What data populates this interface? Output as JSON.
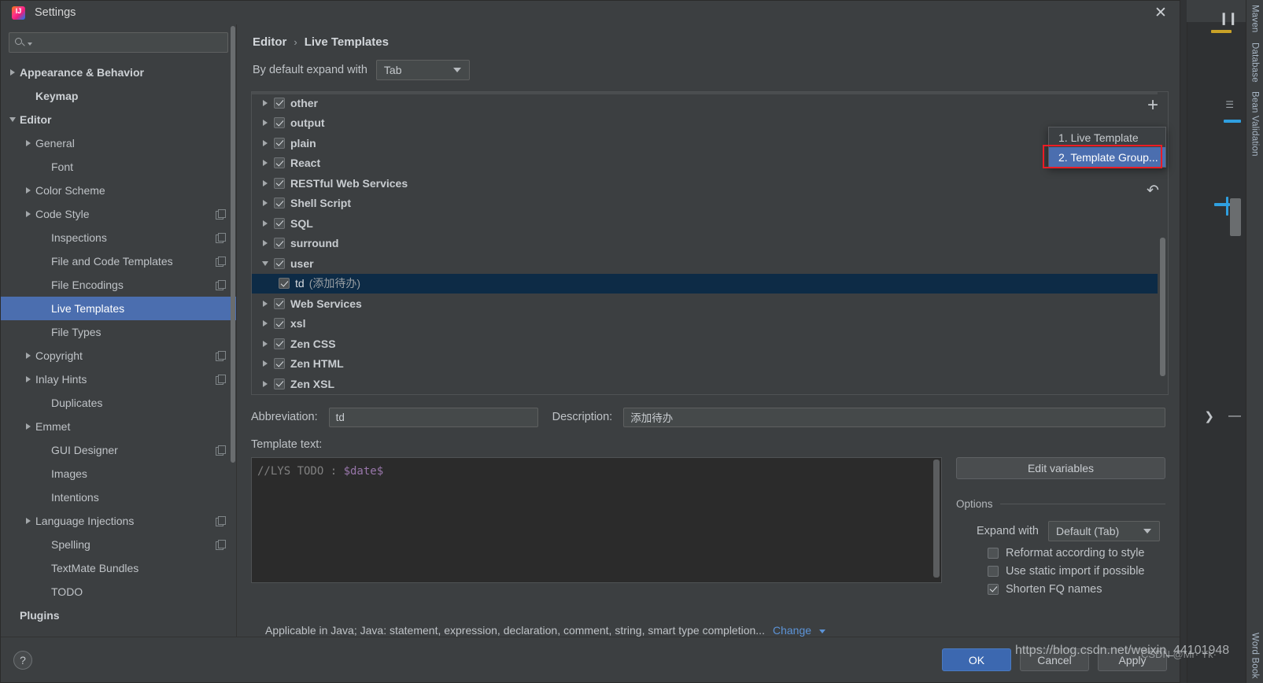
{
  "window": {
    "title": "Settings",
    "close_icon": "close-icon",
    "logo_icon": "intellij-idea-logo"
  },
  "search": {
    "value": "",
    "placeholder": "",
    "icon": "search-icon"
  },
  "sidebar": {
    "items": [
      {
        "label": "Appearance & Behavior",
        "indent": 0,
        "arrow": "collapsed",
        "bold": true,
        "copy": false,
        "selected": false
      },
      {
        "label": "Keymap",
        "indent": 1,
        "arrow": "none",
        "bold": true,
        "copy": false,
        "selected": false
      },
      {
        "label": "Editor",
        "indent": 0,
        "arrow": "expanded",
        "bold": true,
        "copy": false,
        "selected": false
      },
      {
        "label": "General",
        "indent": 1,
        "arrow": "collapsed",
        "bold": false,
        "copy": false,
        "selected": false
      },
      {
        "label": "Font",
        "indent": 2,
        "arrow": "none",
        "bold": false,
        "copy": false,
        "selected": false
      },
      {
        "label": "Color Scheme",
        "indent": 1,
        "arrow": "collapsed",
        "bold": false,
        "copy": false,
        "selected": false
      },
      {
        "label": "Code Style",
        "indent": 1,
        "arrow": "collapsed",
        "bold": false,
        "copy": true,
        "selected": false
      },
      {
        "label": "Inspections",
        "indent": 2,
        "arrow": "none",
        "bold": false,
        "copy": true,
        "selected": false
      },
      {
        "label": "File and Code Templates",
        "indent": 2,
        "arrow": "none",
        "bold": false,
        "copy": true,
        "selected": false
      },
      {
        "label": "File Encodings",
        "indent": 2,
        "arrow": "none",
        "bold": false,
        "copy": true,
        "selected": false
      },
      {
        "label": "Live Templates",
        "indent": 2,
        "arrow": "none",
        "bold": false,
        "copy": false,
        "selected": true
      },
      {
        "label": "File Types",
        "indent": 2,
        "arrow": "none",
        "bold": false,
        "copy": false,
        "selected": false
      },
      {
        "label": "Copyright",
        "indent": 1,
        "arrow": "collapsed",
        "bold": false,
        "copy": true,
        "selected": false
      },
      {
        "label": "Inlay Hints",
        "indent": 1,
        "arrow": "collapsed",
        "bold": false,
        "copy": true,
        "selected": false
      },
      {
        "label": "Duplicates",
        "indent": 2,
        "arrow": "none",
        "bold": false,
        "copy": false,
        "selected": false
      },
      {
        "label": "Emmet",
        "indent": 1,
        "arrow": "collapsed",
        "bold": false,
        "copy": false,
        "selected": false
      },
      {
        "label": "GUI Designer",
        "indent": 2,
        "arrow": "none",
        "bold": false,
        "copy": true,
        "selected": false
      },
      {
        "label": "Images",
        "indent": 2,
        "arrow": "none",
        "bold": false,
        "copy": false,
        "selected": false
      },
      {
        "label": "Intentions",
        "indent": 2,
        "arrow": "none",
        "bold": false,
        "copy": false,
        "selected": false
      },
      {
        "label": "Language Injections",
        "indent": 1,
        "arrow": "collapsed",
        "bold": false,
        "copy": true,
        "selected": false
      },
      {
        "label": "Spelling",
        "indent": 2,
        "arrow": "none",
        "bold": false,
        "copy": true,
        "selected": false
      },
      {
        "label": "TextMate Bundles",
        "indent": 2,
        "arrow": "none",
        "bold": false,
        "copy": false,
        "selected": false
      },
      {
        "label": "TODO",
        "indent": 2,
        "arrow": "none",
        "bold": false,
        "copy": false,
        "selected": false
      },
      {
        "label": "Plugins",
        "indent": 0,
        "arrow": "none",
        "bold": true,
        "copy": false,
        "selected": false
      }
    ]
  },
  "breadcrumb": {
    "parent": "Editor",
    "separator": "›",
    "current": "Live Templates"
  },
  "expand": {
    "label": "By default expand with",
    "value": "Tab"
  },
  "templates": {
    "rows": [
      {
        "name": "other",
        "desc": "",
        "arrow": "collapsed",
        "checked": true,
        "leaf": false,
        "selected": false
      },
      {
        "name": "output",
        "desc": "",
        "arrow": "collapsed",
        "checked": true,
        "leaf": false,
        "selected": false
      },
      {
        "name": "plain",
        "desc": "",
        "arrow": "collapsed",
        "checked": true,
        "leaf": false,
        "selected": false
      },
      {
        "name": "React",
        "desc": "",
        "arrow": "collapsed",
        "checked": true,
        "leaf": false,
        "selected": false
      },
      {
        "name": "RESTful Web Services",
        "desc": "",
        "arrow": "collapsed",
        "checked": true,
        "leaf": false,
        "selected": false
      },
      {
        "name": "Shell Script",
        "desc": "",
        "arrow": "collapsed",
        "checked": true,
        "leaf": false,
        "selected": false
      },
      {
        "name": "SQL",
        "desc": "",
        "arrow": "collapsed",
        "checked": true,
        "leaf": false,
        "selected": false
      },
      {
        "name": "surround",
        "desc": "",
        "arrow": "collapsed",
        "checked": true,
        "leaf": false,
        "selected": false
      },
      {
        "name": "user",
        "desc": "",
        "arrow": "expanded",
        "checked": true,
        "leaf": false,
        "selected": false
      },
      {
        "name": "td",
        "desc": "(添加待办)",
        "arrow": "none",
        "checked": true,
        "leaf": true,
        "selected": true
      },
      {
        "name": "Web Services",
        "desc": "",
        "arrow": "collapsed",
        "checked": true,
        "leaf": false,
        "selected": false
      },
      {
        "name": "xsl",
        "desc": "",
        "arrow": "collapsed",
        "checked": true,
        "leaf": false,
        "selected": false
      },
      {
        "name": "Zen CSS",
        "desc": "",
        "arrow": "collapsed",
        "checked": true,
        "leaf": false,
        "selected": false
      },
      {
        "name": "Zen HTML",
        "desc": "",
        "arrow": "collapsed",
        "checked": true,
        "leaf": false,
        "selected": false
      },
      {
        "name": "Zen XSL",
        "desc": "",
        "arrow": "collapsed",
        "checked": true,
        "leaf": false,
        "selected": false
      }
    ],
    "toolbar": {
      "add_icon": "plus-icon",
      "remove_icon": "minus-icon",
      "revert_icon": "undo-icon"
    },
    "popup": {
      "items": [
        {
          "label": "1. Live Template",
          "highlighted": false
        },
        {
          "label": "2. Template Group...",
          "highlighted": true
        }
      ]
    }
  },
  "form": {
    "abbreviation_label": "Abbreviation:",
    "abbreviation_value": "td",
    "description_label": "Description:",
    "description_value": "添加待办",
    "template_text_label": "Template text:",
    "template_text_comment": "//LYS TODO : ",
    "template_text_variable": "$date$"
  },
  "options": {
    "edit_variables_label": "Edit variables",
    "legend": "Options",
    "expand_with_label": "Expand with",
    "expand_with_value": "Default (Tab)",
    "checkboxes": [
      {
        "label": "Reformat according to style",
        "checked": false
      },
      {
        "label": "Use static import if possible",
        "checked": false
      },
      {
        "label": "Shorten FQ names",
        "checked": true
      }
    ]
  },
  "applicable": {
    "text": "Applicable in Java; Java: statement, expression, declaration, comment, string, smart type completion...",
    "change_label": "Change"
  },
  "footer": {
    "help_label": "?",
    "ok_label": "OK",
    "cancel_label": "Cancel",
    "apply_label": "Apply"
  },
  "ide": {
    "right_tabs": [
      "Maven",
      "Database",
      "Bean Validation",
      "Word Book"
    ]
  },
  "watermark": {
    "url": "https://blog.csdn.net/weixin_44101948",
    "tag": "CSDN @Mr· Yk·"
  },
  "colors": {
    "accent": "#4b6eaf",
    "selection_tree": "#0d2b46",
    "annotation": "#ec1c24",
    "link": "#5c93d6",
    "variable": "#9876aa"
  }
}
